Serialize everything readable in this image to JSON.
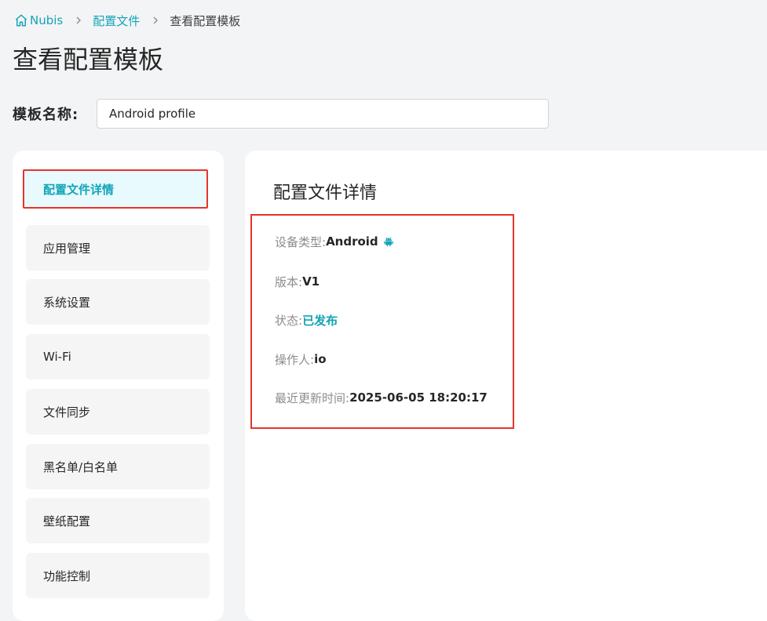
{
  "breadcrumb": {
    "home": "Nubis",
    "section": "配置文件",
    "current": "查看配置模板"
  },
  "page": {
    "title": "查看配置模板"
  },
  "template_name": {
    "label": "模板名称:",
    "value": "Android profile"
  },
  "sidebar": {
    "items": [
      {
        "label": "配置文件详情"
      },
      {
        "label": "应用管理"
      },
      {
        "label": "系统设置"
      },
      {
        "label": "Wi-Fi"
      },
      {
        "label": "文件同步"
      },
      {
        "label": "黑名单/白名单"
      },
      {
        "label": "壁纸配置"
      },
      {
        "label": "功能控制"
      }
    ]
  },
  "details": {
    "title": "配置文件详情",
    "device_type_label": "设备类型:",
    "device_type_value": "Android",
    "version_label": "版本:",
    "version_value": "V1",
    "status_label": "状态:",
    "status_value": "已发布",
    "operator_label": "操作人:",
    "operator_value": "io",
    "updated_label": "最近更新时间:",
    "updated_value": "2025-06-05 18:20:17"
  },
  "colors": {
    "accent": "#11a4b8",
    "highlight_border": "#e8332a",
    "page_bg": "#f3f4f6"
  },
  "icons": {
    "home": "home-icon",
    "separator": "chevron-right-icon",
    "device": "android-icon"
  }
}
